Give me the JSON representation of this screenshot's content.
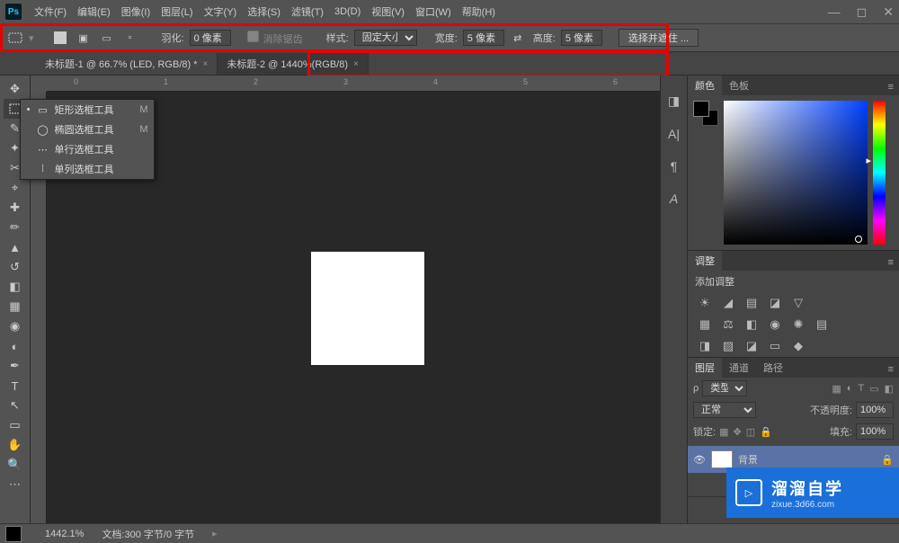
{
  "app": {
    "logo_text": "Ps"
  },
  "menu": [
    "文件(F)",
    "编辑(E)",
    "图像(I)",
    "图层(L)",
    "文字(Y)",
    "选择(S)",
    "滤镜(T)",
    "3D(D)",
    "视图(V)",
    "窗口(W)",
    "帮助(H)"
  ],
  "options": {
    "feather_label": "羽化:",
    "feather_value": "0 像素",
    "antialias": "消除锯齿",
    "style_label": "样式:",
    "style_value": "固定大小",
    "width_label": "宽度:",
    "width_value": "5 像素",
    "height_label": "高度:",
    "height_value": "5 像素",
    "select_mask": "选择并遮住 ..."
  },
  "tabs": [
    {
      "label": "未标题-1 @ 66.7% (LED, RGB/8) *",
      "active": false
    },
    {
      "label": "未标题-2 @ 1440%(RGB/8)",
      "active": true
    }
  ],
  "ruler_h": [
    "0",
    "1",
    "2",
    "3",
    "4",
    "5",
    "6"
  ],
  "marquee_flyout": [
    {
      "dot": "•",
      "icon": "▭",
      "label": "矩形选框工具",
      "shortcut": "M"
    },
    {
      "dot": "",
      "icon": "◯",
      "label": "椭圆选框工具",
      "shortcut": "M"
    },
    {
      "dot": "",
      "icon": "⋯",
      "label": "单行选框工具",
      "shortcut": ""
    },
    {
      "dot": "",
      "icon": "⁞",
      "label": "单列选框工具",
      "shortcut": ""
    }
  ],
  "panels": {
    "color_tabs": [
      "颜色",
      "色板"
    ],
    "adjust_tab": "调整",
    "adjust_title": "添加调整",
    "layers_tabs": [
      "图层",
      "通道",
      "路径"
    ],
    "layer_kind": "类型",
    "blend_mode": "正常",
    "opacity_label": "不透明度:",
    "opacity_value": "100%",
    "lock_label": "锁定:",
    "fill_label": "填充:",
    "fill_value": "100%",
    "layer_name": "背景"
  },
  "status": {
    "zoom": "1442.1%",
    "doc": "文档:300 字节/0 字节"
  },
  "watermark": {
    "title": "溜溜自学",
    "url": "zixue.3d66.com"
  }
}
